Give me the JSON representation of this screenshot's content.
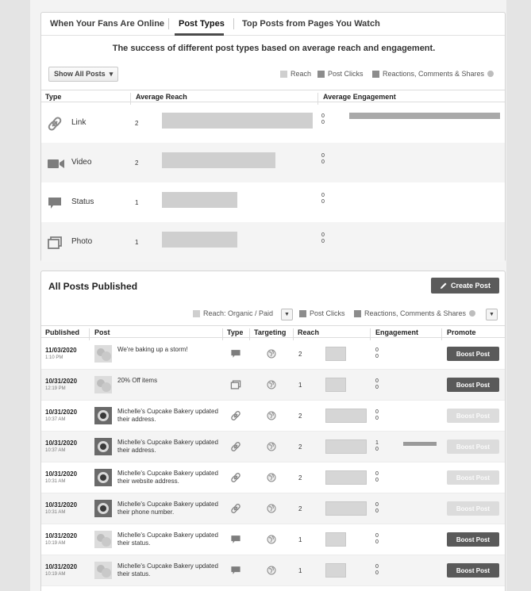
{
  "tabs": [
    "When Your Fans Are Online",
    "Post Types",
    "Top Posts from Pages You Watch"
  ],
  "subtitle": "The success of different post types based on average reach and engagement.",
  "filter": "Show All Posts",
  "legend1": [
    "Reach",
    "Post Clicks",
    "Reactions, Comments & Shares"
  ],
  "type_table": {
    "headers": [
      "Type",
      "Average Reach",
      "Average Engagement"
    ],
    "rows": [
      {
        "type": "Link",
        "icon": "link-icon",
        "reach": "2",
        "reach_fraction": 1.0,
        "eng1": "0",
        "eng2": "0",
        "eng_fraction": 1.0
      },
      {
        "type": "Video",
        "icon": "video-camera-icon",
        "reach": "2",
        "reach_fraction": 0.75,
        "eng1": "0",
        "eng2": "0",
        "eng_fraction": 0
      },
      {
        "type": "Status",
        "icon": "speech-bubble-icon",
        "reach": "1",
        "reach_fraction": 0.5,
        "eng1": "0",
        "eng2": "0",
        "eng_fraction": 0
      },
      {
        "type": "Photo",
        "icon": "photo-icon",
        "reach": "1",
        "reach_fraction": 0.5,
        "eng1": "0",
        "eng2": "0",
        "eng_fraction": 0
      }
    ]
  },
  "all_posts": {
    "title": "All Posts Published",
    "create_label": "Create Post",
    "legend": [
      "Reach: Organic / Paid",
      "Post Clicks",
      "Reactions, Comments & Shares"
    ],
    "headers": [
      "Published",
      "Post",
      "Type",
      "Targeting",
      "Reach",
      "Engagement",
      "Promote"
    ],
    "rows": [
      {
        "date": "11/03/2020",
        "time": "1:10 PM",
        "text": "We're baking up a storm!",
        "thumb": "blurred",
        "type": "status",
        "reach": "2",
        "reach_fraction": 0.5,
        "eng1": "0",
        "eng2": "0",
        "eng_fraction": 0,
        "boost": "Boost Post",
        "boost_enabled": true
      },
      {
        "date": "10/31/2020",
        "time": "12:19 PM",
        "text": "20% Off items",
        "thumb": "blurred",
        "type": "photo",
        "reach": "1",
        "reach_fraction": 0.5,
        "eng1": "0",
        "eng2": "0",
        "eng_fraction": 0,
        "boost": "Boost Post",
        "boost_enabled": true
      },
      {
        "date": "10/31/2020",
        "time": "10:37 AM",
        "text": "Michelle's Cupcake Bakery updated their address.",
        "thumb": "profile",
        "type": "link",
        "reach": "2",
        "reach_fraction": 1.0,
        "eng1": "0",
        "eng2": "0",
        "eng_fraction": 0,
        "boost": "Boost Post",
        "boost_enabled": false
      },
      {
        "date": "10/31/2020",
        "time": "10:37 AM",
        "text": "Michelle's Cupcake Bakery updated their address.",
        "thumb": "profile",
        "type": "link",
        "reach": "2",
        "reach_fraction": 1.0,
        "eng1": "1",
        "eng2": "0",
        "eng_fraction": 1.0,
        "boost": "Boost Post",
        "boost_enabled": false
      },
      {
        "date": "10/31/2020",
        "time": "10:31 AM",
        "text": "Michelle's Cupcake Bakery updated their website address.",
        "thumb": "profile",
        "type": "link",
        "reach": "2",
        "reach_fraction": 1.0,
        "eng1": "0",
        "eng2": "0",
        "eng_fraction": 0,
        "boost": "Boost Post",
        "boost_enabled": false
      },
      {
        "date": "10/31/2020",
        "time": "10:31 AM",
        "text": "Michelle's Cupcake Bakery updated their phone number.",
        "thumb": "profile",
        "type": "link",
        "reach": "2",
        "reach_fraction": 1.0,
        "eng1": "0",
        "eng2": "0",
        "eng_fraction": 0,
        "boost": "Boost Post",
        "boost_enabled": false
      },
      {
        "date": "10/31/2020",
        "time": "10:19 AM",
        "text": "Michelle's Cupcake Bakery updated their status.",
        "thumb": "blurred",
        "type": "status",
        "reach": "1",
        "reach_fraction": 0.5,
        "eng1": "0",
        "eng2": "0",
        "eng_fraction": 0,
        "boost": "Boost Post",
        "boost_enabled": true
      },
      {
        "date": "10/31/2020",
        "time": "10:19 AM",
        "text": "Michelle's Cupcake Bakery updated their status.",
        "thumb": "blurred",
        "type": "status",
        "reach": "1",
        "reach_fraction": 0.5,
        "eng1": "0",
        "eng2": "0",
        "eng_fraction": 0,
        "boost": "Boost Post",
        "boost_enabled": true
      }
    ]
  }
}
